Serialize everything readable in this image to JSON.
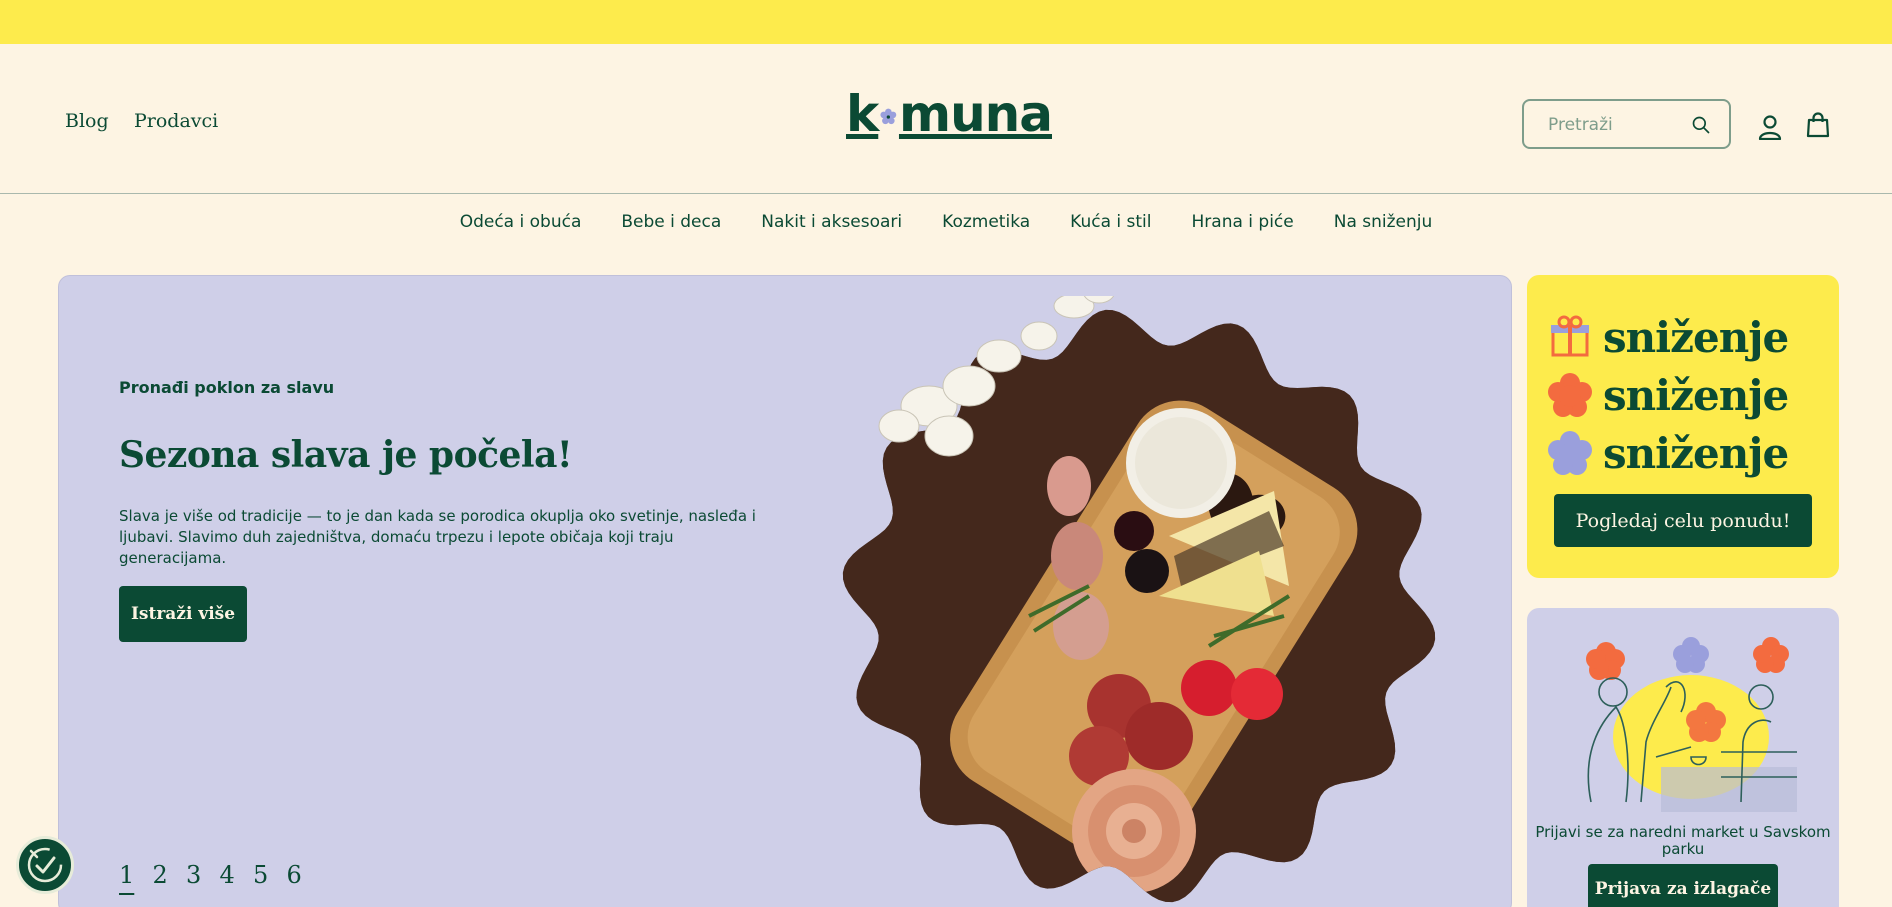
{
  "colors": {
    "brand": "#0b4a34",
    "topbar": "#fdeb4c",
    "background": "#fdf4e3",
    "hero": "#cfcfe8",
    "promo": "#fdeb4c",
    "accent_orange": "#f36b3f",
    "accent_lavender": "#9a9fdc"
  },
  "header": {
    "links": [
      "Blog",
      "Prodavci"
    ],
    "logo": {
      "prefix": "k",
      "suffix": "muna",
      "flower_icon": "flower-icon"
    },
    "search": {
      "placeholder": "Pretraži",
      "value": "",
      "icon": "search-icon"
    },
    "account_icon": "user-icon",
    "cart_icon": "shopping-bag-icon"
  },
  "categories": [
    "Odeća i obuća",
    "Bebe i deca",
    "Nakit i aksesoari",
    "Kozmetika",
    "Kuća i stil",
    "Hrana i piće",
    "Na sniženju"
  ],
  "hero": {
    "eyebrow": "Pronađi poklon za slavu",
    "title": "Sezona slava je počela!",
    "text": "Slava je više od tradicije — to je dan kada se porodica okuplja oko svetinje, nasleđa i ljubavi. Slavimo duh zajedništva, domaću trpezu i lepote običaja koji traju generacijama.",
    "button": "Istraži više",
    "pages": [
      "1",
      "2",
      "3",
      "4",
      "5",
      "6"
    ],
    "active_page": "1"
  },
  "promo": {
    "rows": [
      "sniženje",
      "sniženje",
      "sniženje"
    ],
    "row_icons": [
      "gift-icon",
      "flower-icon",
      "flower-icon"
    ],
    "button": "Pogledaj celu ponudu!"
  },
  "market": {
    "text": "Prijavi se za naredni market u Savskom parku",
    "button": "Prijava za izlagače"
  },
  "accessibility_badge": "accessibility-check-icon"
}
